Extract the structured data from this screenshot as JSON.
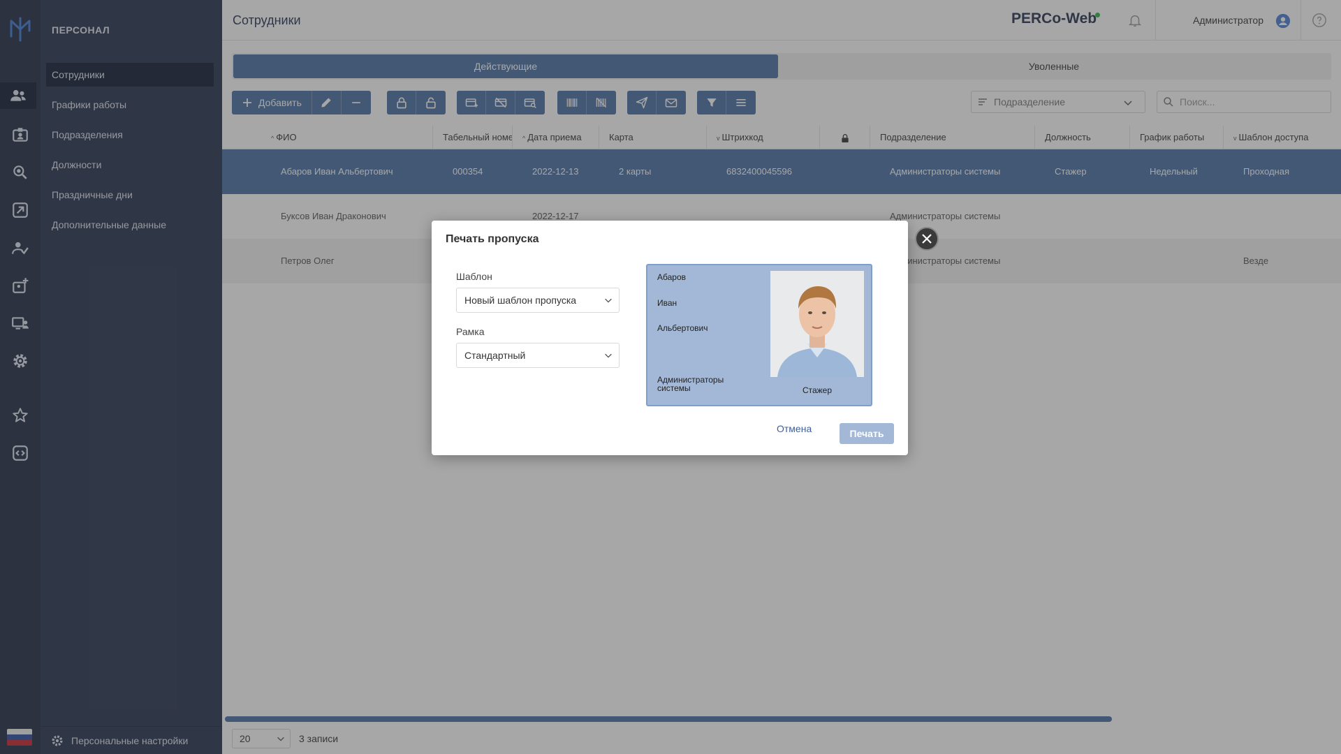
{
  "app": {
    "brand": "PERCo-Web",
    "page_title": "Сотрудники",
    "user": "Администратор"
  },
  "sidebar": {
    "section_title": "ПЕРСОНАЛ",
    "items": [
      {
        "label": "Сотрудники",
        "active": true
      },
      {
        "label": "Графики работы"
      },
      {
        "label": "Подразделения"
      },
      {
        "label": "Должности"
      },
      {
        "label": "Праздничные дни"
      },
      {
        "label": "Дополнительные данные"
      }
    ],
    "footer_label": "Персональные настройки"
  },
  "tabs": {
    "active": "Действующие",
    "inactive": "Уволенные"
  },
  "toolbar": {
    "add_label": "Добавить",
    "department_placeholder": "Подразделение",
    "search_placeholder": "Поиск..."
  },
  "table": {
    "columns": [
      "ФИО",
      "Табельный номер",
      "Дата приема",
      "Карта",
      "Штрихкод",
      "",
      "Подразделение",
      "Должность",
      "График работы",
      "Шаблон доступа"
    ],
    "rows": [
      {
        "name": "Абаров Иван Альбертович",
        "tab_no": "000354",
        "hire_date": "2022-12-13",
        "card": "2 карты",
        "barcode": "6832400045596",
        "dept": "Администраторы системы",
        "position": "Стажер",
        "schedule": "Недельный",
        "access": "Проходная"
      },
      {
        "name": "Буксов Иван Драконович",
        "tab_no": "",
        "hire_date": "2022-12-17",
        "card": "",
        "barcode": "",
        "dept": "Администраторы системы",
        "position": "",
        "schedule": "",
        "access": ""
      },
      {
        "name": "Петров Олег",
        "tab_no": "",
        "hire_date": "",
        "card": "",
        "barcode": "",
        "dept": "Администраторы системы",
        "position": "",
        "schedule": "",
        "access": "Везде"
      }
    ]
  },
  "footer": {
    "page_size": "20",
    "records": "3 записи"
  },
  "modal": {
    "title": "Печать пропуска",
    "template_label": "Шаблон",
    "template_value": "Новый шаблон пропуска",
    "frame_label": "Рамка",
    "frame_value": "Стандартный",
    "card": {
      "last_name": "Абаров",
      "first_name": "Иван",
      "middle_name": "Альбертович",
      "department": "Администраторы системы",
      "position": "Стажер"
    },
    "cancel_label": "Отмена",
    "print_label": "Печать"
  },
  "colors": {
    "accent": "#4a6fa5",
    "sidebar_bg": "#26324f",
    "rail_bg": "#1f2a44",
    "brand_dot": "#33b249"
  }
}
